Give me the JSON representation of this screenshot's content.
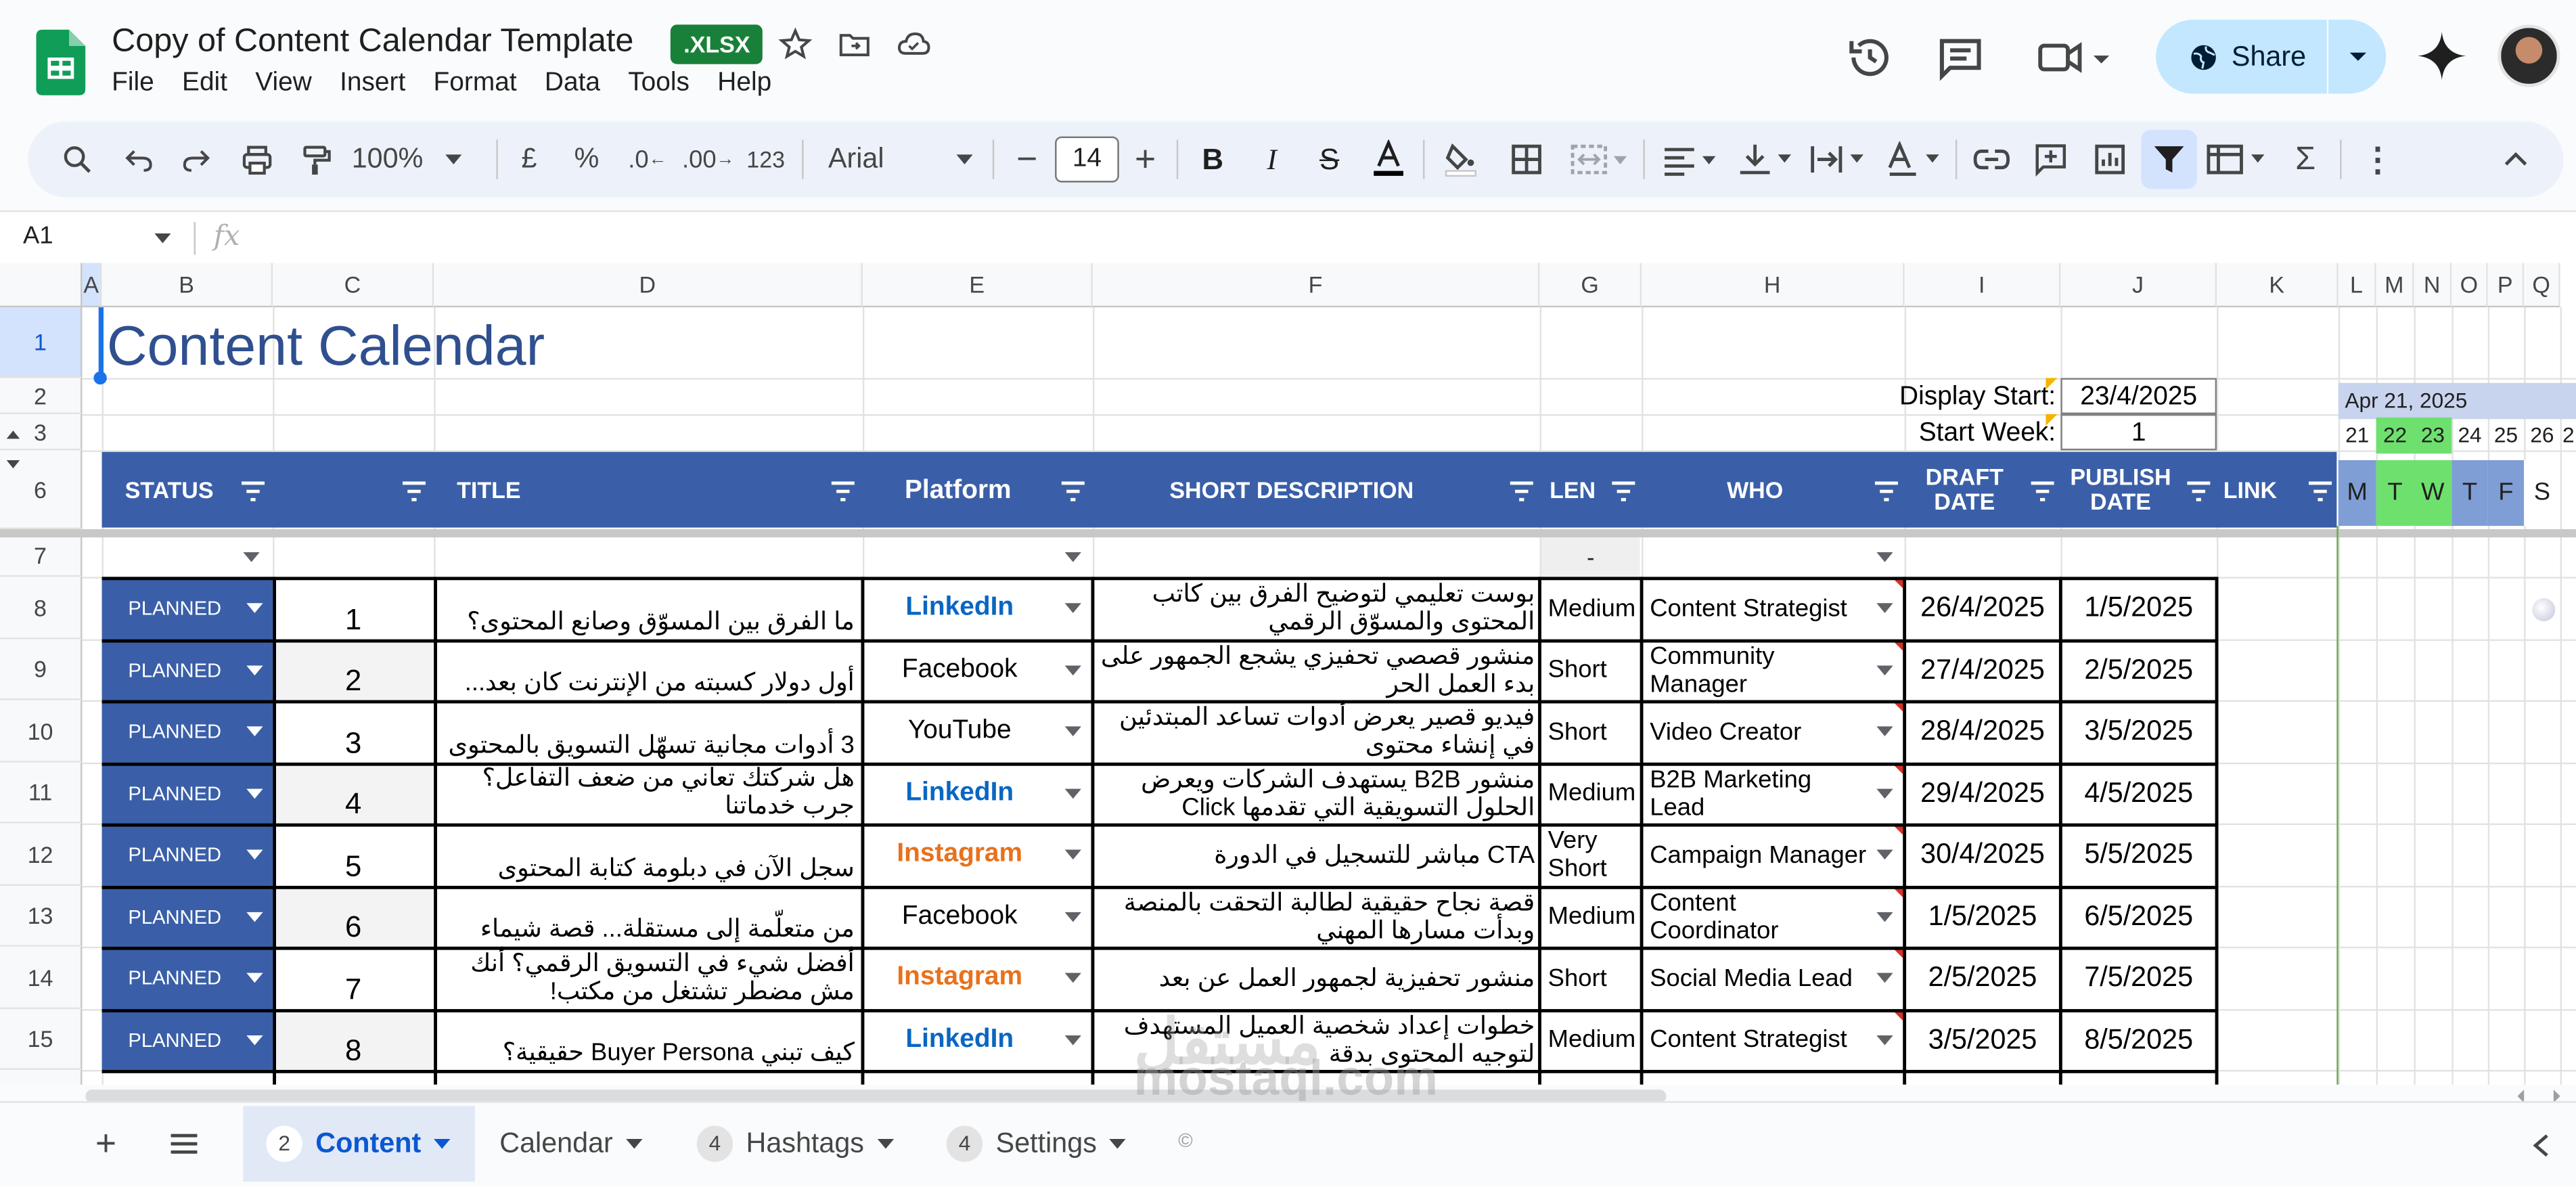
{
  "app": {
    "doc_title": "Copy of Content Calendar Template",
    "file_badge": ".XLSX",
    "menu": [
      "File",
      "Edit",
      "View",
      "Insert",
      "Format",
      "Data",
      "Tools",
      "Help"
    ],
    "share_label": "Share"
  },
  "toolbar": {
    "zoom": "100%",
    "currency": "£",
    "percent": "%",
    "dec_decrease": ".0",
    "dec_increase": ".00",
    "number_format": "123",
    "font_name": "Arial",
    "font_size": "14"
  },
  "formula_bar": {
    "name_box": "A1",
    "fx": "fx",
    "content": ""
  },
  "columns": [
    "A",
    "B",
    "C",
    "D",
    "E",
    "F",
    "G",
    "H",
    "I",
    "J",
    "K",
    "L",
    "M",
    "N",
    "O",
    "P",
    "Q"
  ],
  "rows": [
    "1",
    "2",
    "3",
    "6",
    "7",
    "8",
    "9",
    "10",
    "11",
    "12",
    "13",
    "14",
    "15"
  ],
  "sheet": {
    "title": "Content Calendar",
    "display_start_label": "Display Start:",
    "display_start_value": "23/4/2025",
    "start_week_label": "Start Week:",
    "start_week_value": "1",
    "headers": {
      "status": "STATUS",
      "title": "TITLE",
      "platform": "Platform",
      "short_description": "SHORT DESCRIPTION",
      "len": "LEN",
      "who": "WHO",
      "draft_date": "DRAFT DATE",
      "publish_date": "PUBLISH DATE",
      "link": "LINK"
    },
    "row7_len": "-",
    "calendar": {
      "month_label": "Apr 21, 2025",
      "day_numbers": [
        "21",
        "22",
        "23",
        "24",
        "25",
        "26",
        "2"
      ],
      "day_letters": [
        "M",
        "T",
        "W",
        "T",
        "F",
        "S"
      ]
    },
    "rows": [
      {
        "status": "PLANNED",
        "num": "1",
        "title": "ما الفرق بين المسوّق وصانع المحتوى؟",
        "platform": "LinkedIn",
        "description": "بوست تعليمي لتوضيح الفرق بين كاتب المحتوى والمسوّق الرقمي",
        "len": "Medium",
        "who": "Content Strategist",
        "draft": "26/4/2025",
        "publish": "1/5/2025"
      },
      {
        "status": "PLANNED",
        "num": "2",
        "title": "أول دولار كسبته من الإنترنت كان بعد...",
        "platform": "Facebook",
        "description": "منشور قصصي تحفيزي يشجع الجمهور على بدء العمل الحر",
        "len": "Short",
        "who": "Community Manager",
        "draft": "27/4/2025",
        "publish": "2/5/2025"
      },
      {
        "status": "PLANNED",
        "num": "3",
        "title": "3 أدوات مجانية تسهّل التسويق بالمحتوى",
        "platform": "YouTube",
        "description": "فيديو قصير يعرض أدوات تساعد المبتدئين في إنشاء محتوى",
        "len": "Short",
        "who": "Video Creator",
        "draft": "28/4/2025",
        "publish": "3/5/2025"
      },
      {
        "status": "PLANNED",
        "num": "4",
        "title": "هل شركتك تعاني من ضعف التفاعل؟ جرب خدماتنا",
        "platform": "LinkedIn",
        "description": "منشور B2B يستهدف الشركات ويعرض الحلول التسويقية التي تقدمها Click",
        "len": "Medium",
        "who": "B2B Marketing Lead",
        "draft": "29/4/2025",
        "publish": "4/5/2025"
      },
      {
        "status": "PLANNED",
        "num": "5",
        "title": "سجل الآن في دبلومة كتابة المحتوى",
        "platform": "Instagram",
        "description": "CTA مباشر للتسجيل في الدورة",
        "len": "Very Short",
        "who": "Campaign Manager",
        "draft": "30/4/2025",
        "publish": "5/5/2025"
      },
      {
        "status": "PLANNED",
        "num": "6",
        "title": "من متعلّمة إلى مستقلة... قصة شيماء",
        "platform": "Facebook",
        "description": "قصة نجاح حقيقية لطالبة التحقت بالمنصة وبدأت مسارها المهني",
        "len": "Medium",
        "who": "Content Coordinator",
        "draft": "1/5/2025",
        "publish": "6/5/2025"
      },
      {
        "status": "PLANNED",
        "num": "7",
        "title": "أفضل شيء في التسويق الرقمي؟ أنك مش مضطر تشتغل من مكتب!",
        "platform": "Instagram",
        "description": "منشور تحفيزية لجمهور العمل عن بعد",
        "len": "Short",
        "who": "Social Media Lead",
        "draft": "2/5/2025",
        "publish": "7/5/2025"
      },
      {
        "status": "PLANNED",
        "num": "8",
        "title": "كيف تبني Buyer Persona حقيقية؟",
        "platform": "LinkedIn",
        "description": "خطوات إعداد شخصية العميل المستهدف لتوجيه المحتوى بدقة",
        "len": "Medium",
        "who": "Content Strategist",
        "draft": "3/5/2025",
        "publish": "8/5/2025"
      }
    ]
  },
  "platform_colors": {
    "LinkedIn": "#0a66c2",
    "Instagram": "#e8711c",
    "Facebook": "#000000",
    "YouTube": "#000000"
  },
  "sheet_tabs": [
    {
      "badge": "2",
      "label": "Content",
      "active": true
    },
    {
      "badge": "",
      "label": "Calendar",
      "active": false
    },
    {
      "badge": "4",
      "label": "Hashtags",
      "active": false
    },
    {
      "badge": "4",
      "label": "Settings",
      "active": false
    }
  ],
  "watermark": {
    "ar": "مستقل",
    "en": "mostaql.com"
  }
}
